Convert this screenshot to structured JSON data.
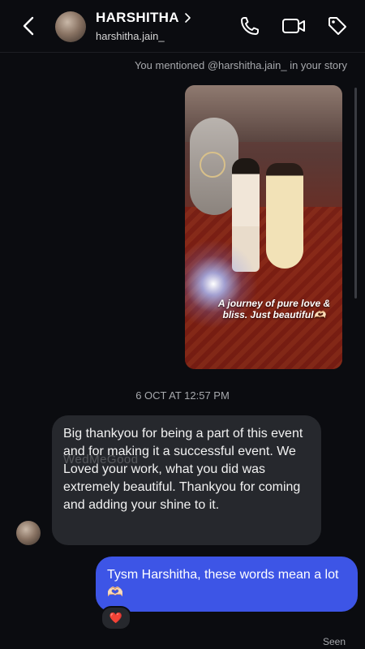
{
  "header": {
    "name": "HARSHITHA",
    "handle": "harshitha.jain_"
  },
  "icons": [
    "back-chevron-icon",
    "avatar",
    "chevron-right-icon",
    "phone-icon",
    "video-icon",
    "tag-icon",
    "heart-reaction-icon"
  ],
  "thread": {
    "mention_note": "You mentioned @harshitha.jain_ in your story",
    "story_caption": "A journey of pure love & bliss. Just beautiful🫶🏻",
    "timestamp": "6 OCT AT 12:57 PM",
    "incoming_message": "Big thankyou for being a part of this event and for making it a successful event. We Loved your work, what you did was extremely beautiful. Thankyou for coming and adding your shine to it.",
    "watermark": "WedMeGood",
    "outgoing_message": "Tysm Harshitha, these words mean a lot🫶🏻",
    "reaction": "❤️",
    "seen_label": "Seen"
  },
  "colors": {
    "background": "#0b0c10",
    "incoming_bubble": "#26282d",
    "outgoing_bubble": "#3d55e6",
    "secondary_text": "#a7a9ad"
  }
}
